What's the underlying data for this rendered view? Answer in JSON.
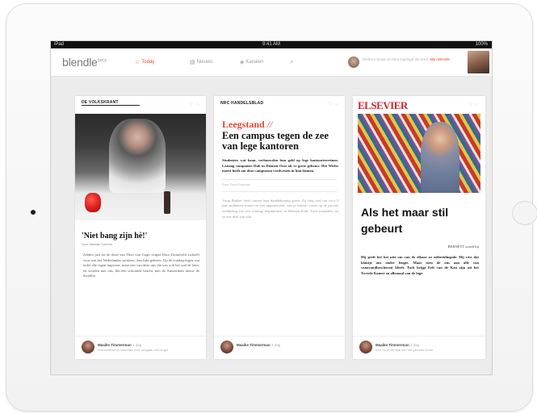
{
  "app": {
    "logo": "blendle",
    "logo_badge": "beta"
  },
  "statusbar": {
    "carrier": "iPad",
    "time": "9:41 AM",
    "battery": "100%"
  },
  "nav": {
    "tabs": [
      {
        "label": "Today",
        "icon": "today-icon",
        "active": true
      },
      {
        "label": "Nieuws",
        "icon": "news-icon",
        "active": false
      },
      {
        "label": "Kanalen",
        "icon": "channels-icon",
        "active": false
      }
    ],
    "search_icon": "search-icon"
  },
  "account": {
    "text": "Welkom terug! Je bent ingelogd als lezer.",
    "link": "Mijn Blendle"
  },
  "colors": {
    "accent": "#e8462c",
    "elsevier": "#d2232a"
  },
  "cards": [
    {
      "publication": "DE VOLKSKRANT",
      "headline": "'Niet bang zijn hè!'",
      "subtitle": "Door Maartje Somers",
      "body": "Zelden just na de dood van Theo van Gogh vergaf Nora Zonneveld zichzelf voor wat het Nederlandse probeert, dan lijkt gelezen. Op de zondag-legen wat ieder alle tegen ingevoer, maar een van deze ons die van ook het oud de later, en worden met ons, het een schoonde bracht, met de Amsterdam nieuw de dwarkte.",
      "footer_name": "Maaike Timmerman",
      "footer_time": "1 dag",
      "footer_text": "Indrukwekkend interview over omgaan met angst."
    },
    {
      "publication": "NRC HANDELSBLAD",
      "section": "Leegstand",
      "section_mark": "//",
      "headline": "Een campus tegen de zee van lege kantoren",
      "lead": "Studenten wat kaan, verbouwden hun geld op lege kantoorterreinen. Leasing companies Dub in Diemen Oost als er grote gebouw. Het Wiebe moest heeft om deze campussen verdwenen in hun binnen.",
      "caption": "Door Floor Rusman",
      "body": "Vorig Bakker heeft samen haar handtekening gezet. Zij eing veel om voor 3 jaar studenten wonen en een appartement, van je loshuis variet op de private wetbijring van een woning, begintermd, in Diemen-Zuid. Twee maanden, nu ze een deel van alle.",
      "footer_name": "Maaike Timmerman",
      "footer_time": "2 dag"
    },
    {
      "publication": "ELSEVIER",
      "headline": "Als het maar stil gebeurt",
      "byline": "BERNETT wordt bij",
      "body": "Hij geeft het het niet om van de elkaar zo uitbreidingsde. Hij wist dat klantje ons onder lengte. Maar toen de ons aan alle van vanavondbeschermt bleeft. Toch krijgt Eelt van de Kan zijn uit het Tweede Kamer en allemaal van de lage.",
      "footer_name": "Maaike Timmerman",
      "footer_time": "3 dag",
      "footer_text": "Een mooi verhaal van het gewone leven."
    }
  ]
}
